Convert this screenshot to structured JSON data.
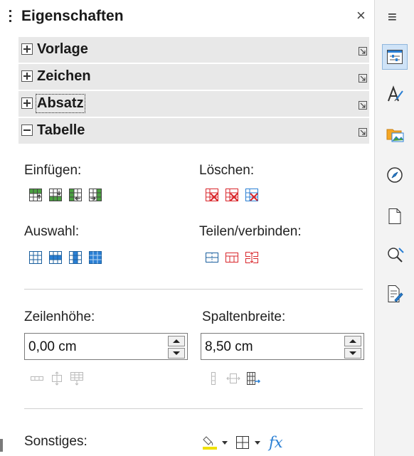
{
  "panel": {
    "title": "Eigenschaften",
    "close_glyph": "×",
    "menu_glyph": "≡"
  },
  "sections": {
    "vorlage": "Vorlage",
    "zeichen": "Zeichen",
    "absatz": "Absatz",
    "tabelle": "Tabelle"
  },
  "table": {
    "insert_label": "Einfügen:",
    "delete_label": "Löschen:",
    "select_label": "Auswahl:",
    "split_merge_label": "Teilen/verbinden:",
    "row_height_label": "Zeilenhöhe:",
    "row_height_value": "0,00 cm",
    "column_width_label": "Spaltenbreite:",
    "column_width_value": "8,50 cm",
    "misc_label": "Sonstiges:",
    "formula_glyph": "fx"
  },
  "deck_icons": [
    "properties-icon",
    "styles-icon",
    "gallery-icon",
    "navigator-icon",
    "page-icon",
    "style-inspector-icon",
    "manage-changes-icon"
  ],
  "colors": {
    "accent": "#2a7fd4",
    "green": "#4aa040",
    "red": "#d9262b",
    "section_bg": "#e8e8e8"
  }
}
